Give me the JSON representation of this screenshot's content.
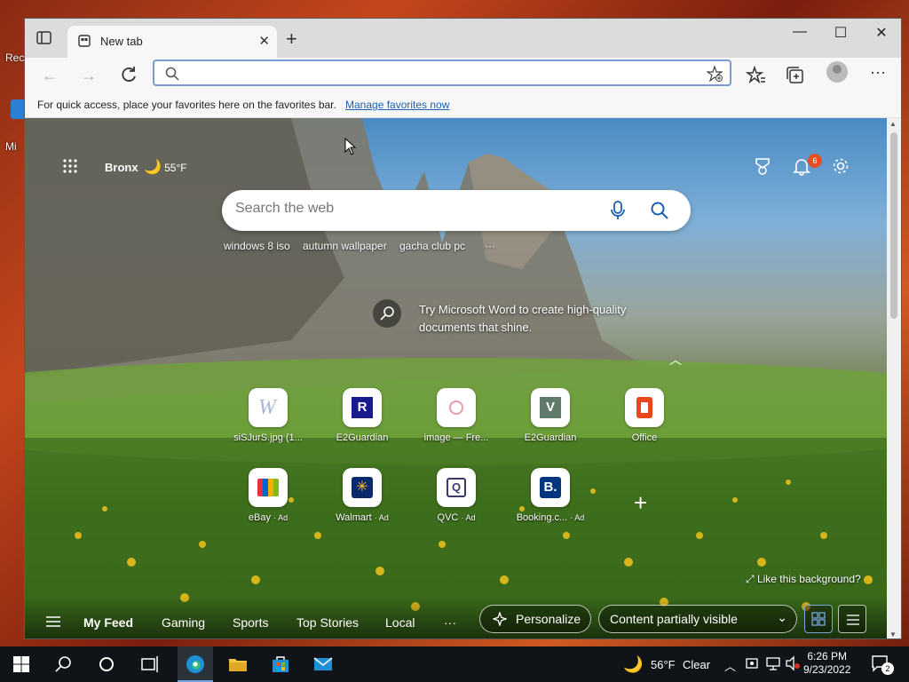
{
  "desktop": {
    "label_top": "Rec",
    "label_mid": "Mi"
  },
  "browser": {
    "tab": {
      "title": "New tab"
    },
    "address_bar": {
      "value": "",
      "placeholder": ""
    },
    "favorites_bar": {
      "message": "For quick access, place your favorites here on the favorites bar.",
      "link": "Manage favorites now"
    }
  },
  "newtab": {
    "weather": {
      "location": "Bronx",
      "temp": "55",
      "unit": "°F"
    },
    "notifications_count": "6",
    "search": {
      "placeholder": "Search the web"
    },
    "trending": [
      "windows 8 iso",
      "autumn wallpaper",
      "gacha club pc"
    ],
    "tip": "Try Microsoft Word to create high-quality documents that shine.",
    "tiles": [
      {
        "label": "siSJurS.jpg (1...",
        "ad": "",
        "icon": "w-icon"
      },
      {
        "label": "E2Guardian",
        "ad": "",
        "icon": "r-icon"
      },
      {
        "label": "image — Fre...",
        "ad": "",
        "icon": "image-icon"
      },
      {
        "label": "E2Guardian",
        "ad": "",
        "icon": "v-icon"
      },
      {
        "label": "Office",
        "ad": "",
        "icon": "office-icon"
      },
      {
        "label": "eBay",
        "ad": "· Ad",
        "icon": "ebay-icon"
      },
      {
        "label": "Walmart",
        "ad": "· Ad",
        "icon": "walmart-icon"
      },
      {
        "label": "QVC",
        "ad": "· Ad",
        "icon": "qvc-icon"
      },
      {
        "label": "Booking.c...",
        "ad": "· Ad",
        "icon": "booking-icon"
      }
    ],
    "like_background": "Like this background?",
    "feed_tabs": [
      "My Feed",
      "Gaming",
      "Sports",
      "Top Stories",
      "Local"
    ],
    "personalize": "Personalize",
    "content_visibility": "Content partially visible"
  },
  "taskbar": {
    "weather": {
      "temp": "56°F",
      "condition": "Clear"
    },
    "time": "6:26 PM",
    "date": "9/23/2022",
    "notification_count": "2"
  },
  "colors": {
    "accent": "#1a5fb4",
    "badge": "#e2502a",
    "taskbar": "#101418"
  }
}
